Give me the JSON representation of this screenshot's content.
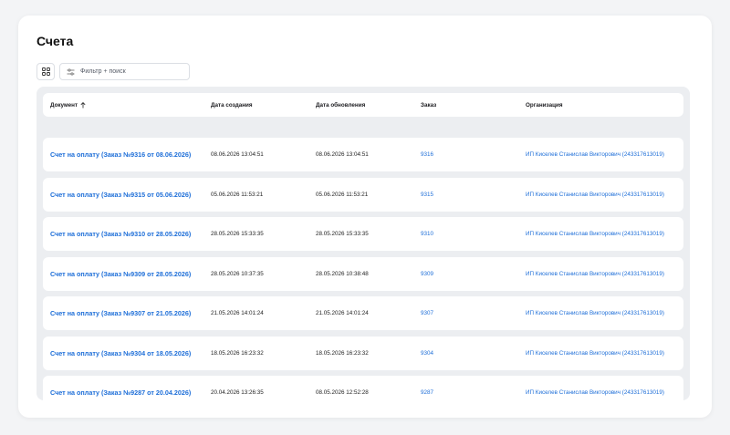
{
  "page": {
    "title": "Счета",
    "filter_placeholder": "Фильтр + поиск"
  },
  "table": {
    "headers": {
      "document": "Документ",
      "created": "Дата создания",
      "updated": "Дата обновления",
      "order": "Заказ",
      "organization": "Организация"
    },
    "sort": {
      "column": "document",
      "direction": "asc"
    },
    "rows": [
      {
        "document": "Счет на оплату (Заказ №9316 от 08.06.2026)",
        "created": "08.06.2026 13:04:51",
        "updated": "08.06.2026 13:04:51",
        "order": "9316",
        "organization": "ИП Киселев Станислав Викторович (243317613019)"
      },
      {
        "document": "Счет на оплату (Заказ №9315 от 05.06.2026)",
        "created": "05.06.2026 11:53:21",
        "updated": "05.06.2026 11:53:21",
        "order": "9315",
        "organization": "ИП Киселев Станислав Викторович (243317613019)"
      },
      {
        "document": "Счет на оплату (Заказ №9310 от 28.05.2026)",
        "created": "28.05.2026 15:33:35",
        "updated": "28.05.2026 15:33:35",
        "order": "9310",
        "organization": "ИП Киселев Станислав Викторович (243317613019)"
      },
      {
        "document": "Счет на оплату (Заказ №9309 от 28.05.2026)",
        "created": "28.05.2026 10:37:35",
        "updated": "28.05.2026 10:38:48",
        "order": "9309",
        "organization": "ИП Киселев Станислав Викторович (243317613019)"
      },
      {
        "document": "Счет на оплату (Заказ №9307 от 21.05.2026)",
        "created": "21.05.2026 14:01:24",
        "updated": "21.05.2026 14:01:24",
        "order": "9307",
        "organization": "ИП Киселев Станислав Викторович (243317613019)"
      },
      {
        "document": "Счет на оплату (Заказ №9304 от 18.05.2026)",
        "created": "18.05.2026 16:23:32",
        "updated": "18.05.2026 16:23:32",
        "order": "9304",
        "organization": "ИП Киселев Станислав Викторович (243317613019)"
      },
      {
        "document": "Счет на оплату (Заказ №9287 от 20.04.2026)",
        "created": "20.04.2026 13:26:35",
        "updated": "08.05.2026 12:52:28",
        "order": "9287",
        "organization": "ИП Киселев Станислав Викторович (243317613019)"
      }
    ]
  },
  "colors": {
    "link": "#1d6ed8",
    "background": "#f3f4f6",
    "table_bg": "#eceef1"
  },
  "icons": {
    "view_toggle": "grid-icon",
    "filter": "filter-sliders-icon",
    "sort": "arrow-up-icon"
  }
}
